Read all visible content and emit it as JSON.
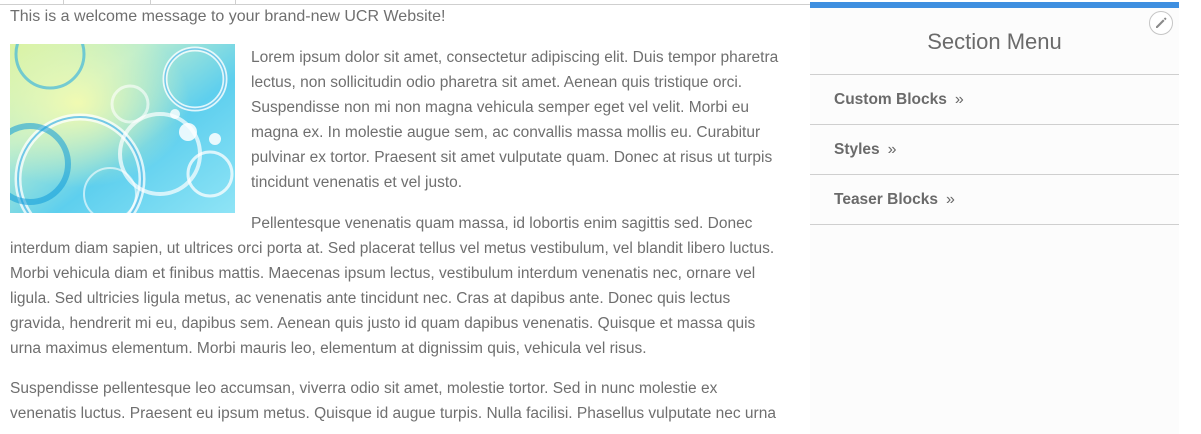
{
  "main": {
    "welcome": "This is a welcome message to your brand-new UCR Website!",
    "paragraph1": "Lorem ipsum dolor sit amet, consectetur adipiscing elit. Duis tempor pharetra lectus, non sollicitudin odio pharetra sit amet. Aenean quis tristique orci. Suspendisse non mi non magna vehicula semper eget vel velit. Morbi eu magna ex. In molestie augue sem, ac convallis massa mollis eu. Curabitur pulvinar ex tortor. Praesent sit amet vulputate quam. Donec at risus ut turpis tincidunt venenatis et vel justo.",
    "paragraph2": "Pellentesque venenatis quam massa, id lobortis enim sagittis sed. Donec interdum diam sapien, ut ultrices orci porta at. Sed placerat tellus vel metus vestibulum, vel blandit libero luctus. Morbi vehicula diam et finibus mattis. Maecenas ipsum lectus, vestibulum interdum venenatis nec, ornare vel ligula. Sed ultricies ligula metus, ac venenatis ante tincidunt nec. Cras at dapibus ante. Donec quis lectus gravida, hendrerit mi eu, dapibus sem. Aenean quis justo id quam dapibus venenatis. Quisque et massa quis urna maximus elementum. Morbi mauris leo, elementum at dignissim quis, vehicula vel risus.",
    "paragraph3": "Suspendisse pellentesque leo accumsan, viverra odio sit amet, molestie tortor. Sed in nunc molestie ex venenatis luctus. Praesent eu ipsum metus. Quisque id augue turpis. Nulla facilisi. Phasellus vulputate nec urna"
  },
  "sidebar": {
    "title": "Section Menu",
    "edit_icon": "pencil-icon",
    "items": [
      {
        "label": "Custom Blocks",
        "chevron": "»"
      },
      {
        "label": "Styles",
        "chevron": "»"
      },
      {
        "label": "Teaser Blocks",
        "chevron": "»"
      }
    ]
  },
  "colors": {
    "accent": "#3e8fe0",
    "text": "#6f6f6f",
    "divider": "#cfcfcf"
  }
}
